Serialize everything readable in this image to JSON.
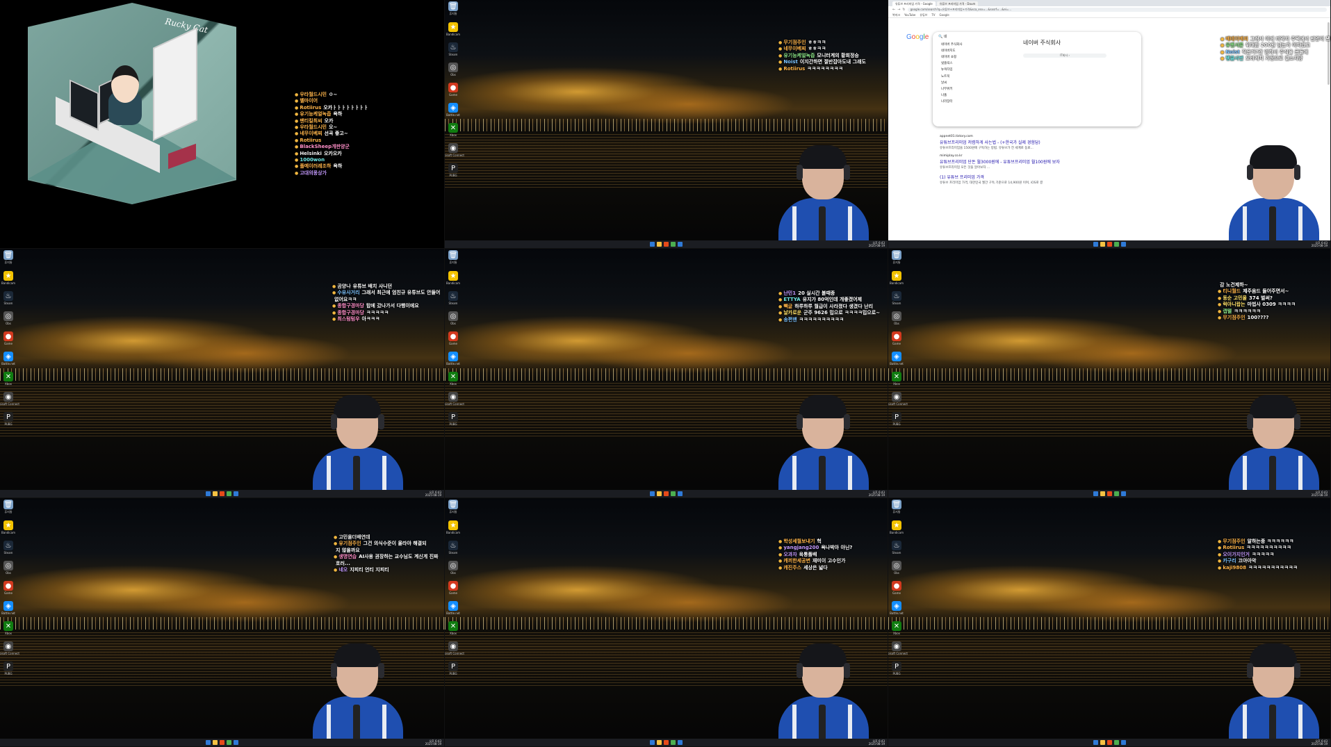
{
  "desktop_icons": [
    {
      "name": "recycle-bin-icon",
      "label": "휴지통",
      "color": "#7aa0c8",
      "glyph": "🗑"
    },
    {
      "name": "star-icon",
      "label": "Bandicam",
      "color": "#f2c200",
      "glyph": "★"
    },
    {
      "name": "steam-icon",
      "label": "Steam",
      "color": "#1b2838",
      "glyph": "♨"
    },
    {
      "name": "shortcut-icon",
      "label": "Obs",
      "color": "#555555",
      "glyph": "◎"
    },
    {
      "name": "red-app-icon",
      "label": "Game",
      "color": "#d33a1f",
      "glyph": "●"
    },
    {
      "name": "battlenet-icon",
      "label": "Battle.net",
      "color": "#148eff",
      "glyph": "◈"
    },
    {
      "name": "xbox-icon",
      "label": "Xbox",
      "color": "#107c10",
      "glyph": "✕"
    },
    {
      "name": "ubisoft-icon",
      "label": "Ubisoft Connect",
      "color": "#444444",
      "glyph": "◉"
    },
    {
      "name": "p-app-icon",
      "label": "PUBG",
      "color": "#222222",
      "glyph": "P"
    }
  ],
  "tray": {
    "time": "오후 6:43",
    "date": "2025-08-19"
  },
  "taskbar_colors": [
    "#2f7ad7",
    "#f5c243",
    "#e64a19",
    "#4caf50",
    "#2f7ad7"
  ],
  "browser": {
    "tabs": [
      "유튜브 프리미엄 가격 - Google",
      "유튜브 프리미엄 가격 - Daum"
    ],
    "url": "google.com/search?q=유튜브+프리미엄+가격&sca_esv=...&sxsrf=...&ei=...",
    "bookmarks": [
      "북마크",
      "YouTube",
      "유튜브",
      "TV",
      "Google"
    ],
    "logo": "Google",
    "query": "네",
    "suggestions": [
      "네이버 주식회사",
      "네이버지도",
      "네이버 쇼핑",
      "넷플릭스",
      "뉴욕타임",
      "노트북",
      "날씨",
      "나무위키",
      "나폴",
      "나라장터"
    ],
    "panel_title": "네이버 주식회사",
    "panel_button": "IT회사 ›",
    "results": [
      {
        "site": "appnet01.tistory.com",
        "title": "유튜브프리미엄 저렴하게 사는법 - (+한국가 실제 경험담)",
        "desc": "유튜브프리미엄을 1500원에 구독하는 방법. 유튜브가 전 세계로 동료..."
      },
      {
        "site": "mimiplay.co.kr",
        "title": "유튜브프리미엄 단돈 월3000원에 - 유튜브프리미엄 월100원에 보자",
        "desc": "유튜브프리미엄 모든 것을 알아보자 ..."
      },
      {
        "site": "",
        "title": "(1) 유튜브 프리미엄 가격",
        "desc": "유튜브 프리미엄 가격, 대한민국 월간 구독 기준으로 14,900원 이며, iOS로 결"
      }
    ]
  },
  "chats": {
    "t1": [
      {
        "name": "우타월드시민",
        "text": "ㅇ~",
        "c": "c-or"
      },
      {
        "name": "벨마이어",
        "text": "",
        "c": "c-or"
      },
      {
        "name": "Rotiirus",
        "text": "오카ㅏㅏㅏㅏㅏㅏㅏㅏ",
        "c": "c-or"
      },
      {
        "name": "유기능케얼녹즙",
        "text": "욕하",
        "c": "c-or"
      },
      {
        "name": "팬티킬최씨",
        "text": "오카",
        "c": "c-or"
      },
      {
        "name": "우타월드시민",
        "text": "오~",
        "c": "c-or"
      },
      {
        "name": "네무이베찌",
        "text": "선곡 좋고~",
        "c": "c-or"
      },
      {
        "name": "Rotiirus",
        "text": "",
        "c": "c-or"
      },
      {
        "name": "BlackSheep개판양군",
        "text": "",
        "c": "c-pk"
      },
      {
        "name": "Helsinki",
        "text": "오카오카",
        "c": "c-wh"
      },
      {
        "name": "1000won",
        "text": "",
        "c": "c-cy"
      },
      {
        "name": "플메이러레조하",
        "text": "욕하",
        "c": "c-or"
      },
      {
        "name": "고대의몽상가",
        "text": "",
        "c": "c-pu"
      }
    ],
    "t2": [
      {
        "name": "무기점주인",
        "text": "ㅎㅎㅋㅋ",
        "c": "c-or"
      },
      {
        "name": "네무이베찌",
        "text": "ㅎㅎㅋㅋ",
        "c": "c-or"
      },
      {
        "name": "유기능케얼녹즙",
        "text": "모니터계의 황희정승",
        "c": "c-gr"
      },
      {
        "name": "Noist",
        "text": "이지간하면 절반잡아도내 그래도",
        "c": "c-bl"
      },
      {
        "name": "Rotiirus",
        "text": "ㅋㅋㅋㅋㅋㅋㅋㅋ",
        "c": "c-or"
      }
    ],
    "t3": [
      {
        "name": "베테이베찌",
        "text": "그래서 이에 비약치 주택에서 반양이 됐어",
        "c": "c-or"
      },
      {
        "name": "유팬서른",
        "text": "위대한 200원 남는가 이자겠고",
        "c": "c-gr"
      },
      {
        "name": "Noist",
        "text": "작은거?건 엄하서 주식을 콘돌에",
        "c": "c-bl"
      },
      {
        "name": "펭클사번",
        "text": "오바케치 가정으로 결소지망",
        "c": "c-cy"
      }
    ],
    "t4": [
      {
        "name": "곰양나",
        "text": "유튜브 배치 사니던",
        "c": "c-wh"
      },
      {
        "name": "수유사거리",
        "text": "그래서 최근에 엄친규 유튜브도 안들어",
        "c": "c-bl"
      },
      {
        "name": "",
        "text": "없어요ㅋㅋ",
        "c": "c-wh"
      },
      {
        "name": "종합구경마당",
        "text": "탑에 갔나가서 다행이에요",
        "c": "c-pk"
      },
      {
        "name": "종합구경마당",
        "text": "ㅋㅋㅋㅋㅋ",
        "c": "c-pk"
      },
      {
        "name": "최스텀텀우",
        "text": "아ㅋㅋㅋ",
        "c": "c-pk"
      }
    ],
    "t5": [
      {
        "name": "난민1",
        "text": "20 실시간 볼때종",
        "c": "c-pu"
      },
      {
        "name": "ETTYA",
        "text": "유지가 80억인데 개좋겠어제",
        "c": "c-cy"
      },
      {
        "name": "빽글",
        "text": "하루하루 월급이 사라졌다 생겼다 난리",
        "c": "c-or"
      },
      {
        "name": "날카로운",
        "text": "군주 9626 밉으로 ㅋㅋㅋㅋ밉으로~",
        "c": "c-ye"
      },
      {
        "name": "송편맨",
        "text": "ㅋㅋㅋㅋㅋㅋㅋㅋㅋㅋ",
        "c": "c-bl"
      }
    ],
    "t6": [
      {
        "name": "",
        "text": "감 노건제하~",
        "c": "c-wh"
      },
      {
        "name": "티니월드",
        "text": "제주움드 들어주면서~",
        "c": "c-or"
      },
      {
        "name": "동순 고민울",
        "text": "374 벌써?",
        "c": "c-ye"
      },
      {
        "name": "럭아니랍는",
        "text": "마법사 0309 ㅋㅋㅋㅋ",
        "c": "c-ye"
      },
      {
        "name": "캡텔",
        "text": "ㅋㅋㅋㅋㅋㅋ",
        "c": "c-gr"
      },
      {
        "name": "무기점주인",
        "text": "100????",
        "c": "c-or"
      }
    ],
    "t7": [
      {
        "name": "고민을더배연데",
        "text": "",
        "c": "c-wh"
      },
      {
        "name": "유기점주인",
        "text": "그건 의식수준이 올라야 해결되",
        "c": "c-or"
      },
      {
        "name": "",
        "text": "지 않을까요",
        "c": "c-wh"
      },
      {
        "name": "생명연습",
        "text": "AI사용 권장하는 교수님도 계신게 진짜",
        "c": "c-pk"
      },
      {
        "name": "",
        "text": "호러...",
        "c": "c-wh"
      },
      {
        "name": "네오",
        "text": "지피티 언티 지피티",
        "c": "c-pu"
      }
    ],
    "t8": [
      {
        "name": "학성세월보내기",
        "text": "헉",
        "c": "c-or"
      },
      {
        "name": "yangjang200",
        "text": "욕나박아 아닌?",
        "c": "c-pu"
      },
      {
        "name": "오과자",
        "text": "육통폴배",
        "c": "c-pu"
      },
      {
        "name": "캐끼한세공변",
        "text": "재미이 고수인가",
        "c": "c-or"
      },
      {
        "name": "캐진주스",
        "text": "세상은 넓다",
        "c": "c-or"
      }
    ],
    "t9": [
      {
        "name": "무기점주인",
        "text": "알하는종 ㅋㅋㅋㅋㅋㅋ",
        "c": "c-or"
      },
      {
        "name": "Rotiirus",
        "text": "ㅋㅋㅋㅋㅋㅋㅋㅋㅋㅋ",
        "c": "c-or"
      },
      {
        "name": "오이가지인거",
        "text": "ㅋㅋㅋㅋㅋ",
        "c": "c-pu"
      },
      {
        "name": "카구리",
        "text": "끄아아악",
        "c": "c-bl"
      },
      {
        "name": "kaji9808",
        "text": "ㅋㅋㅋㅋㅋㅋㅋㅋㅋㅋㅋ",
        "c": "c-or"
      }
    ]
  },
  "room": {
    "sign": "Rucky Cat"
  }
}
